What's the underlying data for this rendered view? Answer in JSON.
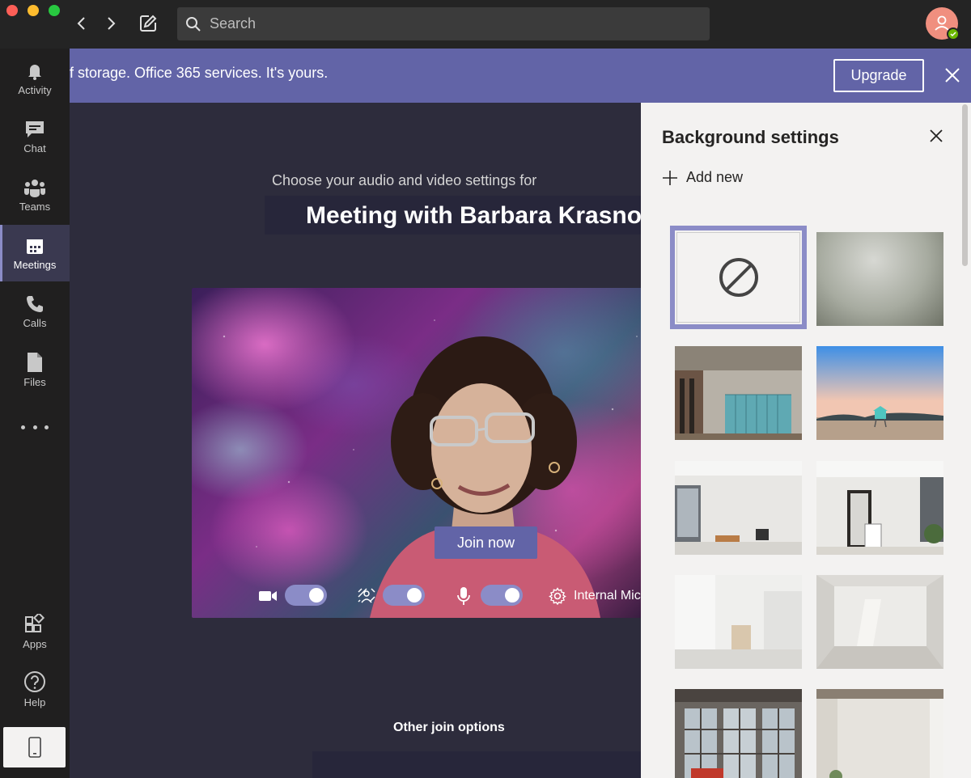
{
  "titlebar": {
    "search_placeholder": "Search"
  },
  "rail": {
    "items": [
      {
        "label": "Activity"
      },
      {
        "label": "Chat"
      },
      {
        "label": "Teams"
      },
      {
        "label": "Meetings"
      },
      {
        "label": "Calls"
      },
      {
        "label": "Files"
      }
    ],
    "apps_label": "Apps",
    "help_label": "Help"
  },
  "banner": {
    "text": "f storage. Office 365 services. It's yours.",
    "upgrade_label": "Upgrade"
  },
  "prejoin": {
    "subtitle": "Choose your audio and video settings for",
    "meeting_title": "Meeting with Barbara Krasnoff",
    "join_label": "Join now",
    "device_label": "Internal Mic",
    "other_options_label": "Other join options"
  },
  "background_panel": {
    "title": "Background settings",
    "add_new_label": "Add new",
    "thumbnails": [
      "none",
      "blur",
      "office",
      "beach",
      "loft-1",
      "loft-2",
      "white-room",
      "studio",
      "industrial",
      "plain-room"
    ]
  },
  "colors": {
    "accent": "#6264a7",
    "toggle_on": "#8b8cc7",
    "rail_bg": "#201f1f",
    "stage_bg": "#2d2c3c",
    "presence": "#6bb700"
  }
}
